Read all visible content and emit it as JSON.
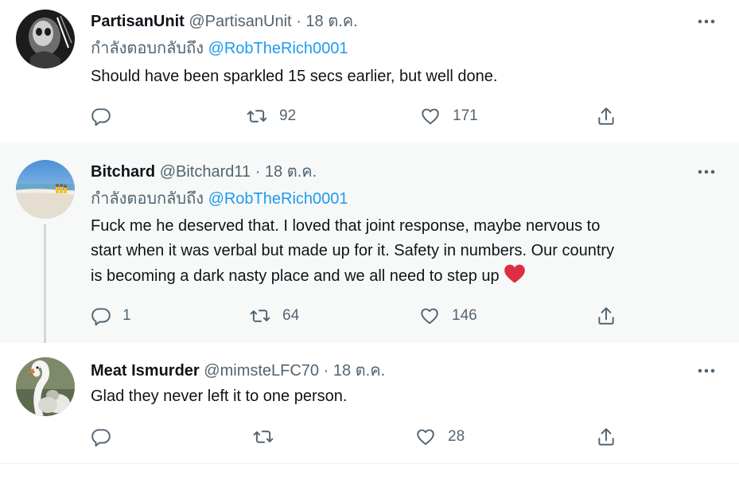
{
  "tweets": [
    {
      "name": "PartisanUnit",
      "handle": "@PartisanUnit",
      "separator": "·",
      "date": "18 ต.ค.",
      "reply_prefix": "กำลังตอบกลับถึง",
      "reply_to": "@RobTheRich0001",
      "text": "Should have been sparkled 15 secs earlier, but well done.",
      "counts": {
        "reply": "",
        "retweet": "92",
        "like": "171"
      }
    },
    {
      "name": "Bitchard",
      "handle": "@Bitchard11",
      "separator": "·",
      "date": "18 ต.ค.",
      "reply_prefix": "กำลังตอบกลับถึง",
      "reply_to": "@RobTheRich0001",
      "text_lines": [
        "Fuck me he deserved that. I loved that joint response, maybe nervous to",
        "start when it was verbal but made up for it. Safety in numbers. Our country",
        "is becoming a dark nasty place and we all need to step up"
      ],
      "emoji": "red-heart-emoji",
      "counts": {
        "reply": "1",
        "retweet": "64",
        "like": "146"
      }
    },
    {
      "name": "Meat Ismurder",
      "handle": "@mimsteLFC70",
      "separator": "·",
      "date": "18 ต.ค.",
      "text": "Glad they never left it to one person.",
      "counts": {
        "reply": "",
        "retweet": "",
        "like": "28"
      }
    }
  ],
  "icons": {
    "reply": "reply-icon",
    "retweet": "retweet-icon",
    "like": "like-icon",
    "share": "share-icon",
    "more": "more-icon"
  },
  "colors": {
    "text": "#0f1419",
    "secondary": "#536471",
    "accent": "#1d9bf0",
    "hover_bg": "#f7f9f9",
    "heart": "#e0245e"
  }
}
